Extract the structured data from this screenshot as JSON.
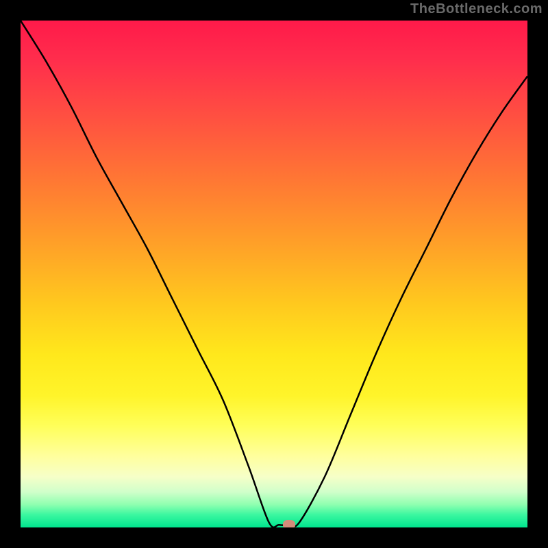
{
  "attribution": "TheBottleneck.com",
  "chart_data": {
    "type": "line",
    "title": "",
    "xlabel": "",
    "ylabel": "",
    "xlim": [
      0,
      100
    ],
    "ylim": [
      0,
      100
    ],
    "grid": false,
    "legend": false,
    "gradient_background": {
      "top_color": "#ff1a4a",
      "bottom_color": "#00e58e",
      "description": "vertical gradient from red (high bottleneck) through orange/yellow to green (low bottleneck)"
    },
    "series": [
      {
        "name": "bottleneck-curve",
        "x": [
          0,
          5,
          10,
          15,
          20,
          25,
          30,
          35,
          40,
          45,
          49,
          51,
          53,
          55,
          60,
          65,
          70,
          75,
          80,
          85,
          90,
          95,
          100
        ],
        "y": [
          100,
          92,
          83,
          73,
          64,
          55,
          45,
          35,
          25,
          12,
          1,
          0.5,
          0.5,
          1,
          10,
          22,
          34,
          45,
          55,
          65,
          74,
          82,
          89
        ]
      }
    ],
    "marker": {
      "x": 53,
      "y": 0.5,
      "color": "#d48c7a",
      "shape": "ellipse"
    }
  }
}
